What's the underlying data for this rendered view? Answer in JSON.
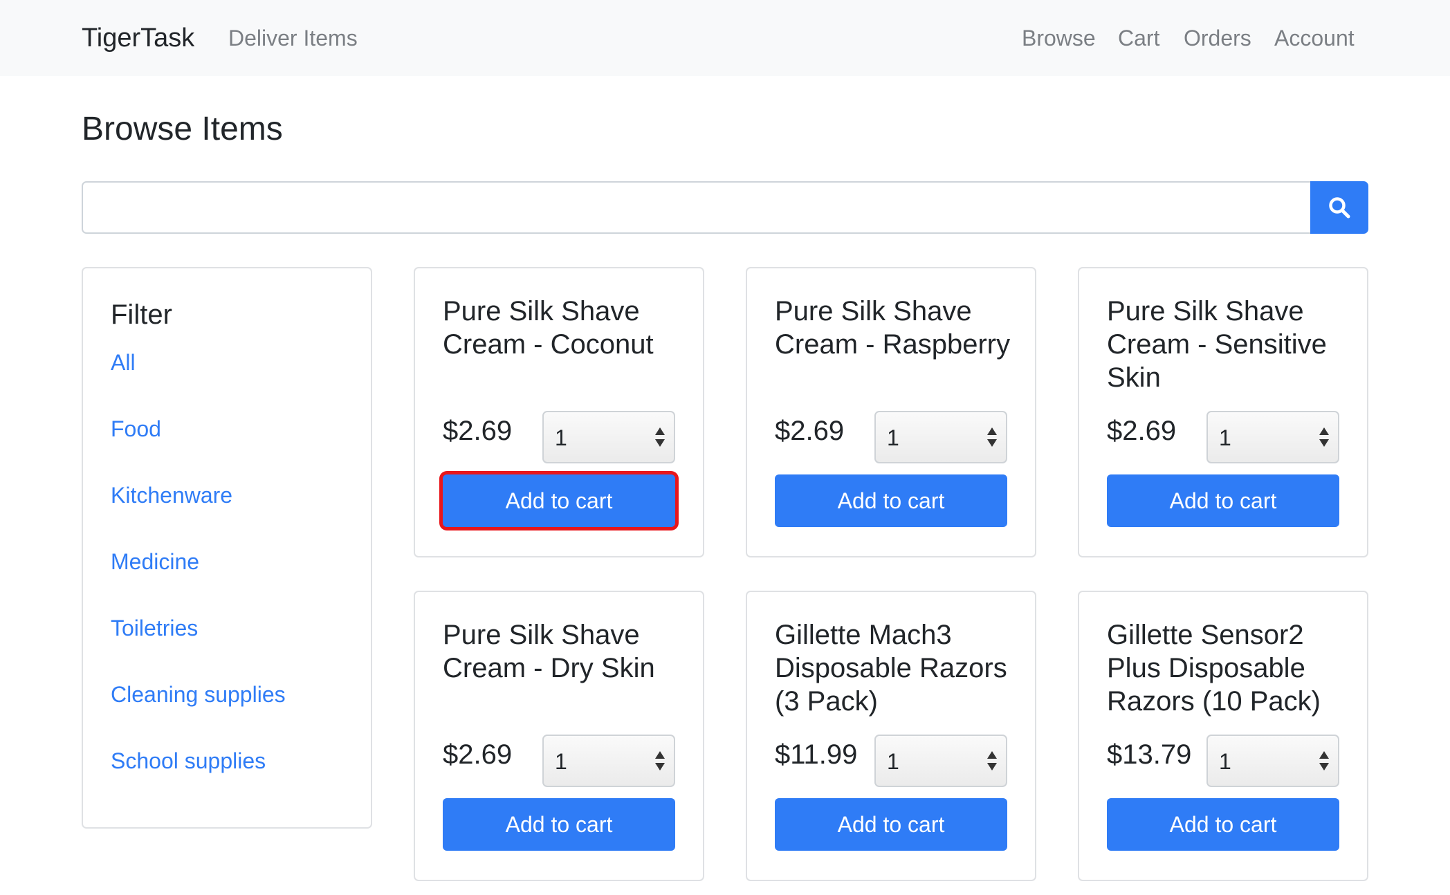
{
  "navbar": {
    "brand": "TigerTask",
    "deliver": "Deliver Items",
    "browse": "Browse",
    "cart": "Cart",
    "orders": "Orders",
    "account": "Account"
  },
  "page_title": "Browse Items",
  "search": {
    "value": "",
    "icon": "search-icon"
  },
  "filter": {
    "title": "Filter",
    "items": [
      "All",
      "Food",
      "Kitchenware",
      "Medicine",
      "Toiletries",
      "Cleaning supplies",
      "School supplies"
    ]
  },
  "products": [
    {
      "name": "Pure Silk Shave Cream - Coconut",
      "price": "$2.69",
      "qty": "1",
      "button": "Add to cart",
      "highlighted": true
    },
    {
      "name": "Pure Silk Shave Cream - Raspberry",
      "price": "$2.69",
      "qty": "1",
      "button": "Add to cart"
    },
    {
      "name": "Pure Silk Shave Cream - Sensitive Skin",
      "price": "$2.69",
      "qty": "1",
      "button": "Add to cart"
    },
    {
      "name": "Pure Silk Shave Cream - Dry Skin",
      "price": "$2.69",
      "qty": "1",
      "button": "Add to cart"
    },
    {
      "name": "Gillette Mach3 Disposable Razors (3 Pack)",
      "price": "$11.99",
      "qty": "1",
      "button": "Add to cart"
    },
    {
      "name": "Gillette Sensor2 Plus Disposable Razors (10 Pack)",
      "price": "$13.79",
      "qty": "1",
      "button": "Add to cart"
    }
  ],
  "colors": {
    "primary": "#2f7cf6",
    "highlight": "#e8161b",
    "navbar_bg": "#f8f9fa"
  }
}
